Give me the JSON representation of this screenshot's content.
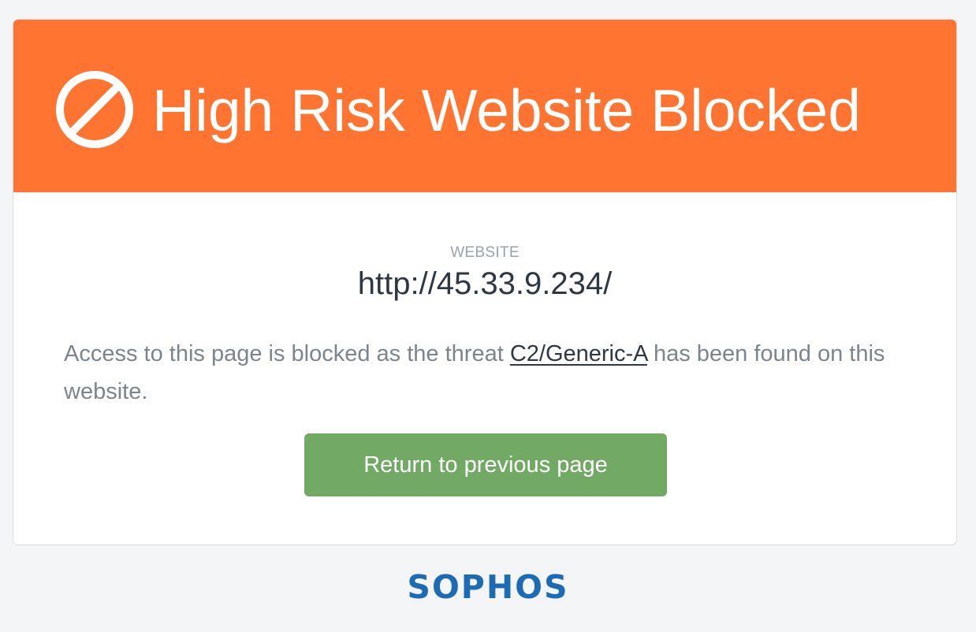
{
  "banner": {
    "icon": "blocked-circle-icon",
    "title": "High Risk Website Blocked",
    "background_color": "#fe7430"
  },
  "website": {
    "label": "WEBSITE",
    "url": "http://45.33.9.234/"
  },
  "message": {
    "prefix": "Access to this page is blocked as the threat ",
    "threat_name": "C2/Generic-A",
    "suffix": " has been found on this website."
  },
  "actions": {
    "return_label": "Return to previous page",
    "return_color": "#72a965"
  },
  "footer": {
    "logo_text": "SOPHOS",
    "logo_color": "#1d6bb5"
  }
}
